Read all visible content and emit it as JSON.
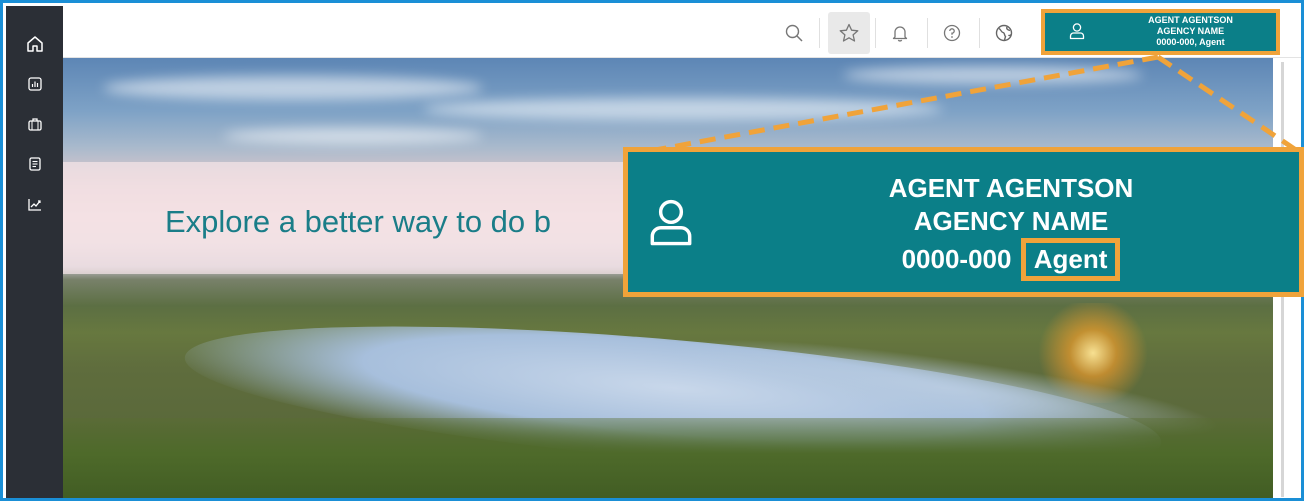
{
  "header": {
    "icons": [
      "search-icon",
      "star-icon",
      "bell-icon",
      "help-icon",
      "globe-icon"
    ]
  },
  "sidebar": {
    "items": [
      "home-icon",
      "reports-icon",
      "briefcase-icon",
      "document-icon",
      "analytics-icon"
    ]
  },
  "profile": {
    "agent_name": "AGENT AGENTSON",
    "agency_name": "AGENCY NAME",
    "code_role": "0000-000, Agent"
  },
  "callout": {
    "agent_name": "AGENT AGENTSON",
    "agency_name": "AGENCY NAME",
    "code": "0000-000",
    "role": "Agent"
  },
  "hero": {
    "title": "Explore a better way to do b"
  },
  "colors": {
    "teal": "#0b7f88",
    "highlight": "#f0a33a",
    "sidebar": "#2b2f36",
    "frame": "#1a8fd6"
  }
}
